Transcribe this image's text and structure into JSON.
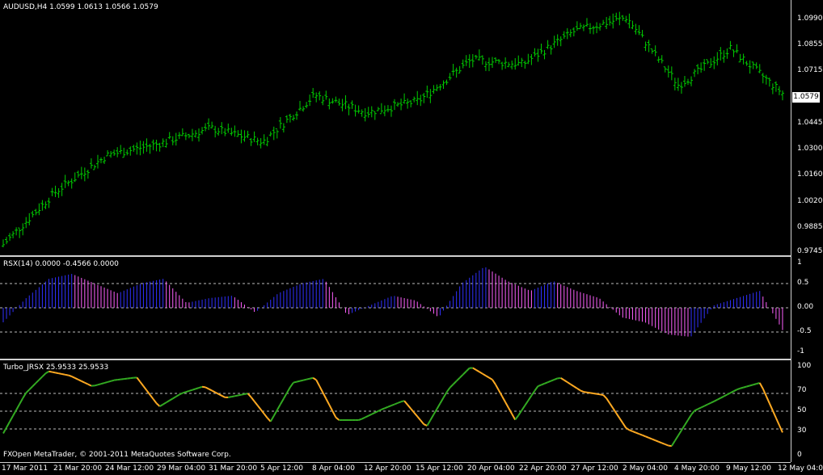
{
  "main": {
    "title": "AUDUSD,H4  1.0599 1.0613 1.0566 1.0579",
    "price_labels": [
      "1.0990",
      "1.0855",
      "1.0715",
      "1.0445",
      "1.0300",
      "1.0160",
      "1.0020",
      "0.9885",
      "0.9745"
    ],
    "current_price": "1.0579"
  },
  "rsx": {
    "title": "RSX(14) 0.0000 -0.4566 0.0000",
    "levels": [
      "1",
      "0.5",
      "0.00",
      "-0.5",
      "-1"
    ]
  },
  "jrsx": {
    "title": "Turbo_JRSX 25.9533 25.9533",
    "levels": [
      "100",
      "70",
      "50",
      "30",
      "0"
    ]
  },
  "copyright": "FXOpen MetaTrader, © 2001-2011 MetaQuotes Software Corp.",
  "time_labels": [
    "17 Mar 2011",
    "21 Mar 20:00",
    "24 Mar 12:00",
    "29 Mar 04:00",
    "31 Mar 20:00",
    "5 Apr 12:00",
    "8 Apr 04:00",
    "12 Apr 20:00",
    "15 Apr 12:00",
    "20 Apr 04:00",
    "22 Apr 20:00",
    "27 Apr 12:00",
    "2 May 04:00",
    "4 May 20:00",
    "9 May 12:00",
    "12 May 04:00"
  ],
  "colors": {
    "bars": "#00cc00",
    "rsx_up": "#3030ff",
    "rsx_down": "#ff60ff",
    "jrsx_up": "#33aa22",
    "jrsx_down": "#ffaa22"
  },
  "chart_data": [
    {
      "type": "line",
      "title": "AUDUSD,H4",
      "x": [
        "17 Mar 2011",
        "21 Mar 20:00",
        "24 Mar 12:00",
        "29 Mar 04:00",
        "31 Mar 20:00",
        "5 Apr 12:00",
        "8 Apr 04:00",
        "12 Apr 20:00",
        "15 Apr 12:00",
        "20 Apr 04:00",
        "22 Apr 20:00",
        "27 Apr 12:00",
        "2 May 04:00",
        "4 May 20:00",
        "9 May 12:00",
        "12 May 04:00"
      ],
      "series": [
        {
          "values": [
            0.98,
            1.007,
            1.026,
            1.032,
            1.04,
            1.033,
            1.057,
            1.048,
            1.054,
            1.075,
            1.073,
            1.09,
            1.097,
            1.062,
            1.081,
            1.058
          ]
        }
      ],
      "ylim": [
        0.9745,
        1.106
      ]
    },
    {
      "type": "bar",
      "title": "RSX(14)",
      "values": [
        -0.3,
        0.2,
        0.6,
        0.7,
        0.5,
        0.3,
        0.5,
        0.6,
        0.1,
        0.2,
        0.25,
        -0.1,
        0.3,
        0.5,
        0.6,
        -0.15,
        0.05,
        0.25,
        0.15,
        -0.2,
        0.5,
        0.85,
        0.55,
        0.35,
        0.55,
        0.35,
        0.2,
        -0.2,
        -0.3,
        -0.55,
        -0.6,
        0.05,
        0.2,
        0.35,
        -0.46
      ],
      "ylim": [
        -1,
        1
      ]
    },
    {
      "type": "line",
      "title": "Turbo_JRSX",
      "values": [
        25,
        70,
        95,
        90,
        78,
        85,
        88,
        55,
        70,
        78,
        65,
        70,
        38,
        82,
        88,
        40,
        40,
        52,
        62,
        32,
        75,
        100,
        85,
        40,
        78,
        88,
        72,
        68,
        30,
        20,
        10,
        50,
        62,
        75,
        82,
        26
      ],
      "ylim": [
        0,
        100
      ]
    }
  ]
}
